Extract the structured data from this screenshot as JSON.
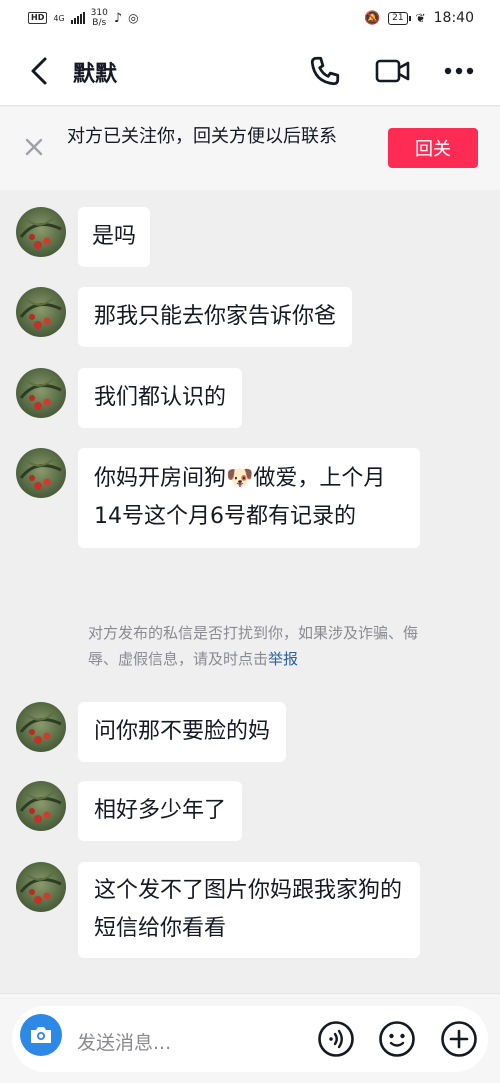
{
  "status_bar": {
    "hd": "HD",
    "network": "4G",
    "network_sub": "4G",
    "speed": "310",
    "speed_unit": "B/s",
    "battery": "21",
    "time": "18:40"
  },
  "header": {
    "title": "默默"
  },
  "follow_prompt": {
    "text": "对方已关注你，回关方便以后联系",
    "button": "回关"
  },
  "messages": [
    {
      "text": "是吗"
    },
    {
      "text": "那我只能去你家告诉你爸"
    },
    {
      "text": "我们都认识的"
    },
    {
      "text": "你妈开房间狗🐶做爱，上个月14号这个月6号都有记录的"
    },
    {
      "text": "问你那不要脸的妈"
    },
    {
      "text": "相好多少年了"
    },
    {
      "text": "这个发不了图片你妈跟我家狗的短信给你看看"
    }
  ],
  "notice": {
    "text": "对方发布的私信是否打扰到你，如果涉及诈骗、侮辱、虚假信息，请及时点击",
    "link": "举报"
  },
  "composer": {
    "placeholder": "发送消息..."
  },
  "colors": {
    "accent": "#fe2c55",
    "camera": "#2e88e6",
    "link": "#2a5fa5"
  }
}
